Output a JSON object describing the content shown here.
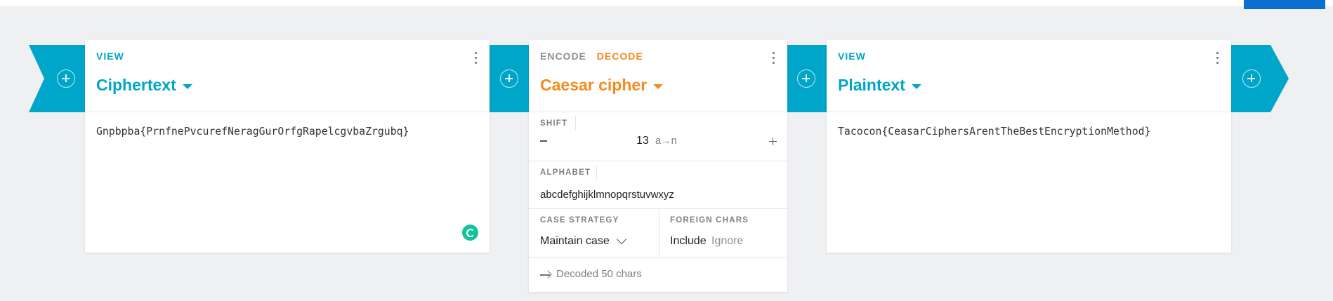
{
  "colors": {
    "view_accent": "#00a6c9",
    "decode_accent": "#f58a1f",
    "ribbon": "#00a6c9",
    "background": "#eff0f2",
    "topbar_accent": "#0a6fd1"
  },
  "icons": {
    "add": "plus-circle-icon",
    "menu": "more-vertical-icon",
    "dropdown": "caret-down-icon",
    "grammarly": "grammarly-icon",
    "status": "arrow-right-icon"
  },
  "cards": {
    "ciphertext": {
      "mode": "VIEW",
      "title": "Ciphertext",
      "content": "Gnpbpba{PrnfnePvcurefNeragGurOrfgRapelcgvbaZrgubq}"
    },
    "caesar": {
      "mode_encode": "ENCODE",
      "mode_decode": "DECODE",
      "title": "Caesar cipher",
      "shift_label": "SHIFT",
      "shift_value": "13",
      "shift_mapping": "a→n",
      "alphabet_label": "ALPHABET",
      "alphabet_value": "abcdefghijklmnopqrstuvwxyz",
      "case_strategy_label": "CASE STRATEGY",
      "case_strategy_value": "Maintain case",
      "foreign_chars_label": "FOREIGN CHARS",
      "foreign_include": "Include",
      "foreign_ignore": "Ignore",
      "status": "Decoded 50 chars"
    },
    "plaintext": {
      "mode": "VIEW",
      "title": "Plaintext",
      "content": "Tacocon{CeasarCiphersArentTheBestEncryptionMethod}"
    }
  }
}
